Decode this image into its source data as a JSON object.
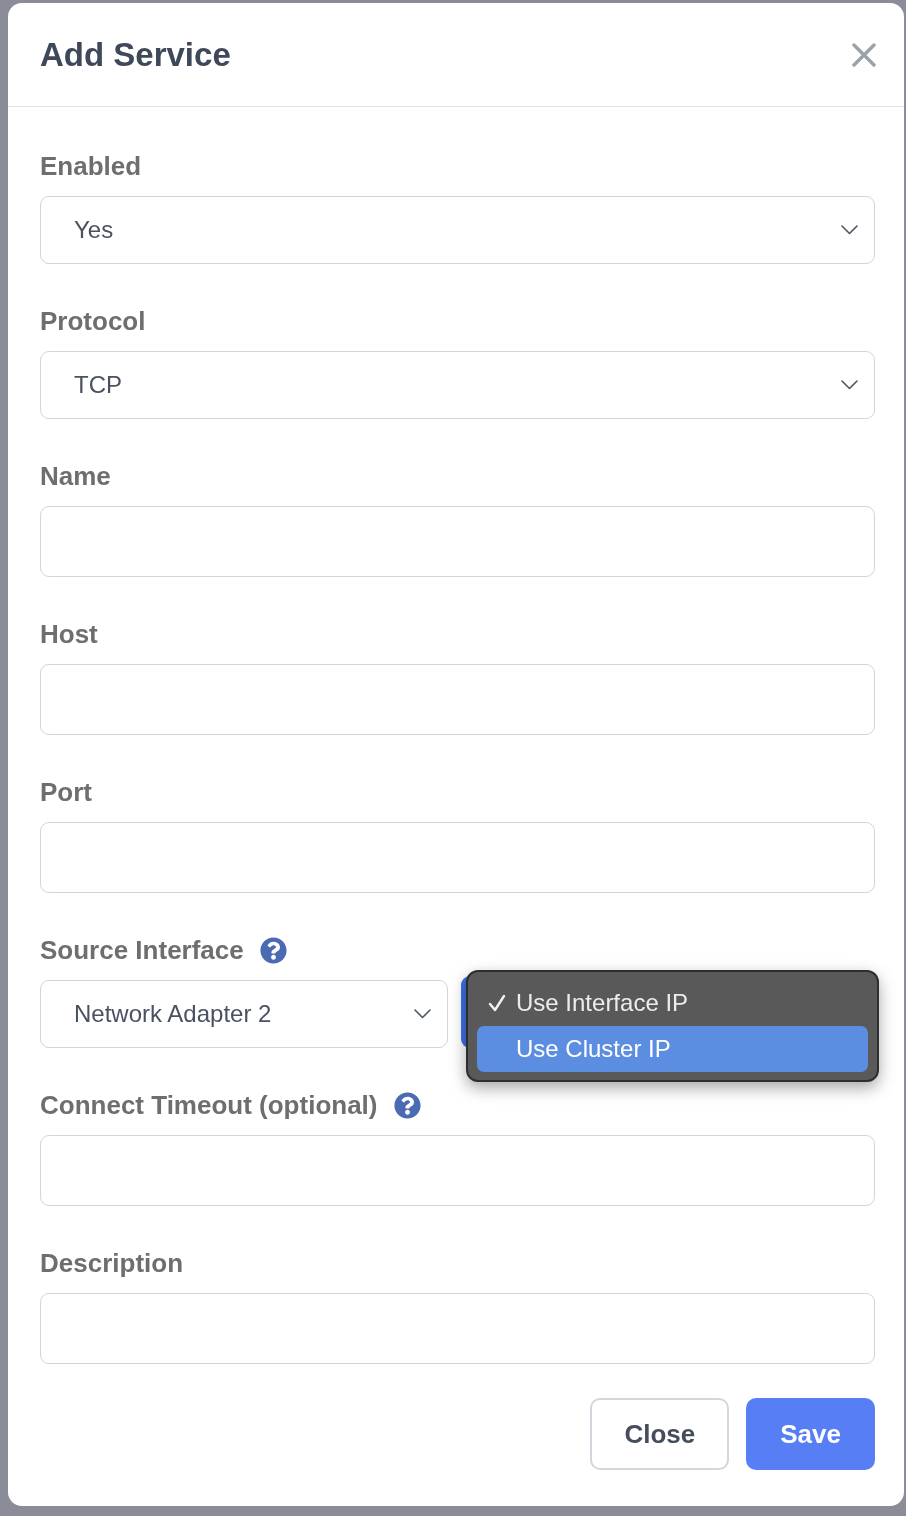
{
  "dialog": {
    "title": "Add Service"
  },
  "fields": [
    {
      "kind": "select",
      "label": "Enabled",
      "value": "Yes"
    },
    {
      "kind": "select",
      "label": "Protocol",
      "value": "TCP"
    },
    {
      "kind": "text",
      "label": "Name"
    },
    {
      "kind": "text",
      "label": "Host"
    },
    {
      "kind": "text",
      "label": "Port"
    },
    {
      "kind": "select-pair",
      "label": "Source Interface",
      "help": true,
      "value": "Network Adapter 2",
      "menu": {
        "options": [
          {
            "label": "Use Interface IP",
            "checked": true,
            "highlighted": false
          },
          {
            "label": "Use Cluster IP",
            "checked": false,
            "highlighted": true
          }
        ]
      }
    },
    {
      "kind": "text",
      "label": "Connect Timeout (optional)",
      "help": true
    },
    {
      "kind": "text",
      "label": "Description"
    }
  ],
  "buttons": [
    {
      "label": "Close",
      "kind": "secondary"
    },
    {
      "label": "Save",
      "kind": "primary"
    }
  ]
}
